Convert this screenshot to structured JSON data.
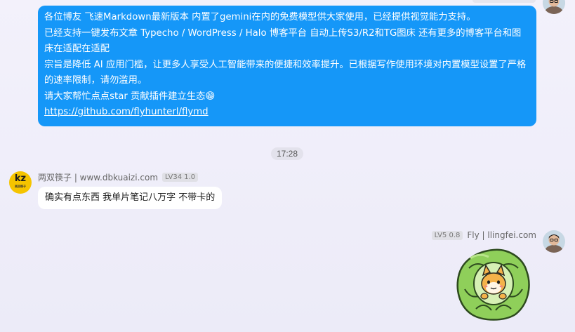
{
  "messages": {
    "blue": {
      "line1": "各位博友  飞速Markdown最新版本 内置了gemini在内的免费模型供大家使用，已经提供视觉能力支持。",
      "line2": "已经支持一键发布文章 Typecho / WordPress / Halo 博客平台  自动上传S3/R2和TG图床 还有更多的博客平台和图床在适配在适配",
      "line3": "宗旨是降低 AI 应用门槛，让更多人享受人工智能带来的便捷和效率提升。已根据写作使用环境对内置模型设置了严格的速率限制，请勿滥用。",
      "line4": "请大家帮忙点点star  贡献插件建立生态😁",
      "link": "https://github.com/flyhunterl/flymd"
    },
    "time": "17:28",
    "incoming": {
      "sender": "两双筷子 | www.dbkuaizi.com",
      "level": "LV34 1.0",
      "text": "确实有点东西 我单片笔记八万字 不带卡的"
    },
    "outgoing": {
      "level": "LV5 0.8",
      "sender": "Fly | llingfei.com"
    }
  },
  "avatars": {
    "kz_logo": "kz",
    "kz_sub": "两双筷子"
  },
  "colors": {
    "blue_bubble": "#1597f8",
    "background": "#efedf9"
  },
  "icons": {
    "sticker": "cabbage-sticker-icon"
  }
}
